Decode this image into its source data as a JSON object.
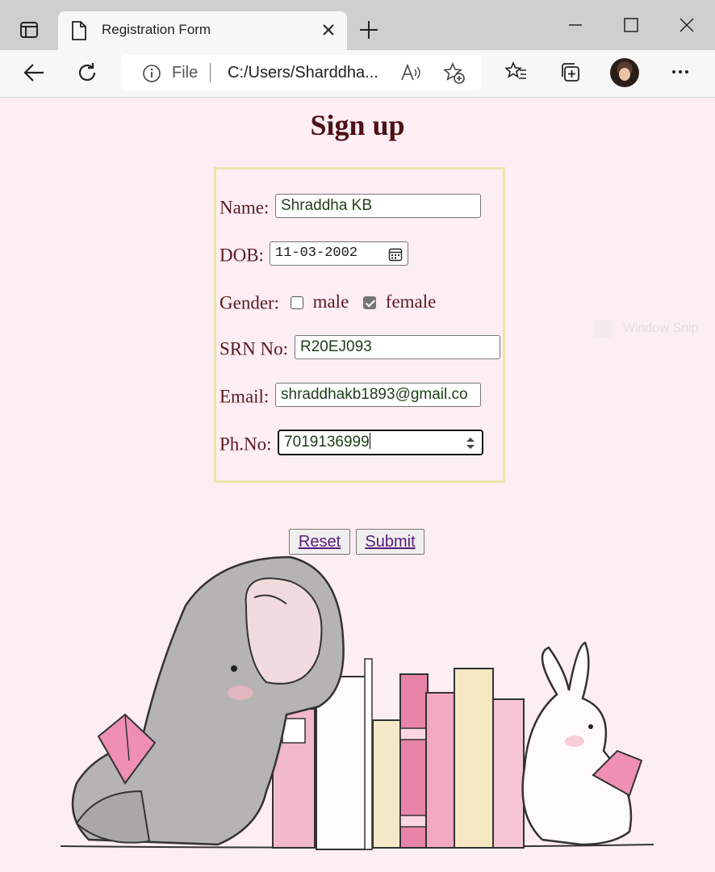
{
  "browser": {
    "tab_title": "Registration Form",
    "address_prefix": "File",
    "url": "C:/Users/Sharddha..."
  },
  "page": {
    "title": "Sign up",
    "fields": {
      "name_label": "Name:",
      "name_value": "Shraddha KB",
      "dob_label": "DOB:",
      "dob_value": "11-03-2002",
      "gender_label": "Gender:",
      "gender_male": "male",
      "gender_female": "female",
      "gender_selected": "female",
      "srn_label": "SRN No:",
      "srn_value": "R20EJ093",
      "email_label": "Email:",
      "email_value": "shraddhakb1893@gmail.co",
      "phone_label": "Ph.No:",
      "phone_value": "7019136999"
    },
    "buttons": {
      "reset": "Reset",
      "submit": "Submit"
    },
    "overlay_text": "Window Snip"
  },
  "colors": {
    "page_background": "#fdeef3",
    "title_color": "#4d1014",
    "form_border": "#ece5aa",
    "link_color": "#5a1a7a"
  },
  "icons": [
    "sidebar-icon",
    "page-icon",
    "close-icon",
    "plus-icon",
    "minimize-icon",
    "maximize-icon",
    "back-icon",
    "refresh-icon",
    "info-icon",
    "read-aloud-icon",
    "add-favorite-icon",
    "favorites-icon",
    "collections-icon",
    "more-icon",
    "calendar-icon",
    "spinner-icon"
  ]
}
